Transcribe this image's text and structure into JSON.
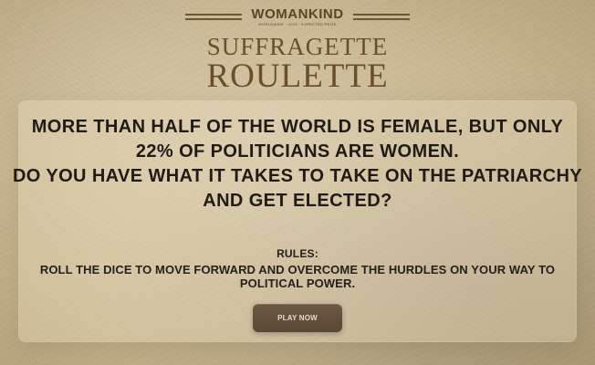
{
  "brand": {
    "name": "WOMANKIND",
    "subtitle": "WORLDWIDE · 2020 · EXPECTED PRIZE"
  },
  "title": {
    "line1": "SUFFRAGETTE",
    "line2": "ROULETTE"
  },
  "headline": {
    "line1": "MORE THAN HALF OF THE WORLD IS FEMALE, BUT ONLY",
    "line2": "22% OF POLITICIANS ARE WOMEN.",
    "line3": "DO YOU HAVE WHAT IT TAKES TO TAKE ON THE PATRIARCHY",
    "line4": "AND GET ELECTED?"
  },
  "rules": {
    "title": "RULES:",
    "line1": "ROLL THE DICE TO MOVE FORWARD AND OVERCOME THE HURDLES ON YOUR WAY TO",
    "line2": "POLITICAL POWER."
  },
  "cta": {
    "play_label": "PLAY NOW"
  },
  "colors": {
    "background": "#cbb994",
    "brand": "#5c4527",
    "title": "#6a4d29",
    "text": "#1f1b15",
    "button": "#5b4732",
    "button_text": "#e7dcc8"
  }
}
